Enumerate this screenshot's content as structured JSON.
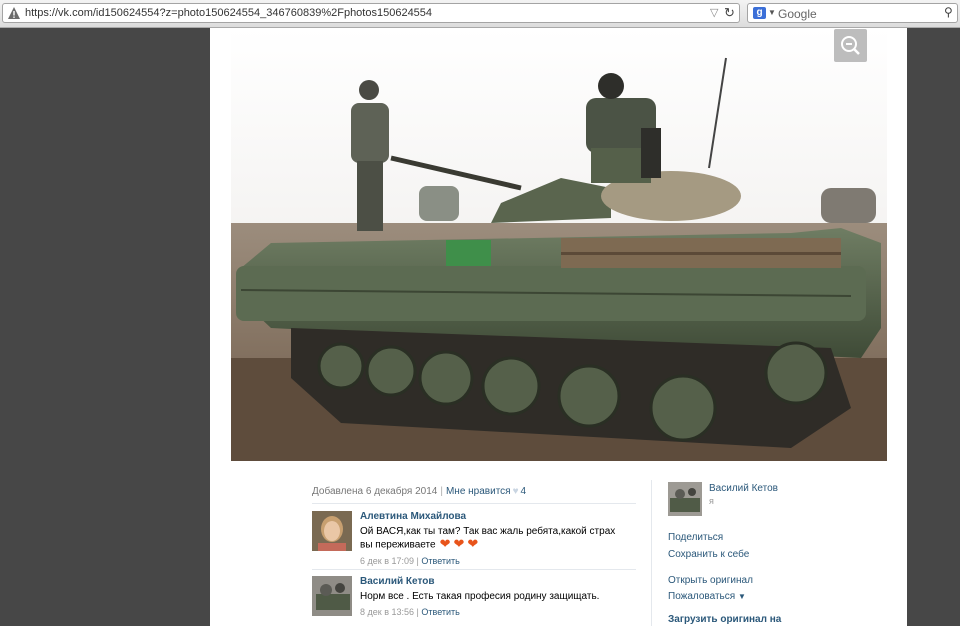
{
  "browser": {
    "url": "https://vk.com/id150624554?z=photo150624554_346760839%2Fphotos150624554",
    "search_engine_letter": "g",
    "search_placeholder": "Google"
  },
  "photo": {
    "alt": "Soldiers on an armored vehicle"
  },
  "info": {
    "added": "Добавлена 6 декабря 2014",
    "like_label": "Мне нравится",
    "like_count": "4"
  },
  "comments": [
    {
      "author": "Алевтина Михайлова",
      "text": "Ой ВАСЯ,как ты там? Так вас жаль ребята,какой страх вы переживаете",
      "emoji": [
        "heart",
        "heart",
        "heart"
      ],
      "date": "6 дек в 17:09",
      "reply": "Ответить"
    },
    {
      "author": "Василий Кетов",
      "text": "Норм все . Есть такая професия родину защищать.",
      "date": "8 дек в 13:56",
      "reply": "Ответить"
    }
  ],
  "sidebar": {
    "owner_name": "Василий Кетов",
    "owner_sub": "я",
    "share": "Поделиться",
    "save": "Сохранить к себе",
    "open_original": "Открыть оригинал",
    "report": "Пожаловаться",
    "upload_original": "Загрузить оригинал на"
  },
  "colors": {
    "link": "#2b587a",
    "background": "#474747",
    "heart": "#e8541b"
  }
}
